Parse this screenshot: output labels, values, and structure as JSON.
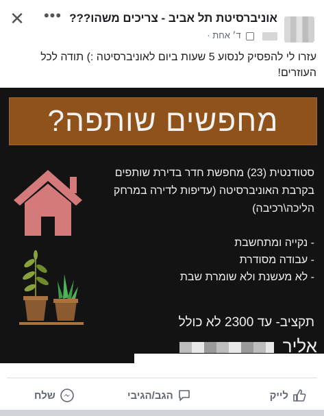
{
  "header": {
    "group_title": "אוניברסיטת תל אביב - צריכים משהו???",
    "meta_time": "ד׳ אחת",
    "meta_sep": "·"
  },
  "post": {
    "text": "עזרו לי להפסיק לנסוע 5 שעות ביום לאוניברסיטה :) תודה לכל העוזרים!"
  },
  "image": {
    "headline": "מחפשים שותפה?",
    "description": "סטודנטית (23) מחפשת חדר בדירת שותפים בקרבת האוניברסיטה (עדיפות לדירה במרחק הליכה\\רכיבה)",
    "bullets": [
      "נקייה ומתחשבת",
      "עבודה מסודרת",
      "לא מעשנת ולא שומרת שבת"
    ],
    "budget": "תקציב- עד 2300 לא כולל",
    "contact_name": "אליר",
    "colors": {
      "band": "#8f521a",
      "house": "#d47a7a",
      "background": "#131313"
    }
  },
  "actions": {
    "like": "לייק",
    "comment": "הגב/הגיבי",
    "send": "שלח"
  },
  "icons": {
    "close": "✕",
    "more": "•••",
    "like": "thumbs-up-icon",
    "comment": "speech-bubble-icon",
    "send": "messenger-icon"
  }
}
